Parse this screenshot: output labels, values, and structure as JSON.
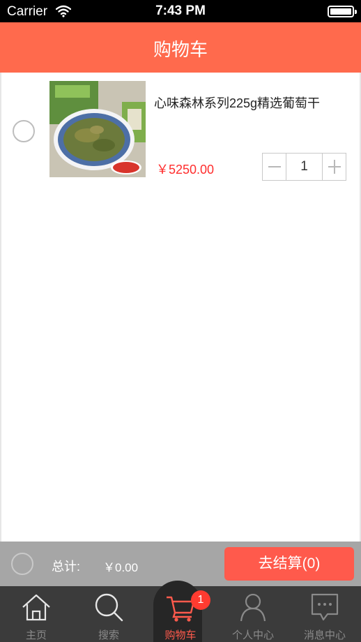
{
  "status_bar": {
    "carrier": "Carrier",
    "time": "7:43 PM"
  },
  "header": {
    "title": "购物车"
  },
  "cart": {
    "items": [
      {
        "name": "心味森林系列225g精选葡萄干",
        "price": "￥5250.00",
        "quantity": "1",
        "selected": false,
        "thumb_logo": "心味果园"
      }
    ]
  },
  "checkout": {
    "total_label": "总计:",
    "total_value": "￥0.00",
    "button_label": "去结算(0)"
  },
  "tabbar": {
    "tabs": [
      {
        "label": "主页",
        "icon": "home-icon"
      },
      {
        "label": "搜索",
        "icon": "search-icon"
      },
      {
        "label": "购物车",
        "icon": "cart-icon",
        "active": true,
        "badge": "1"
      },
      {
        "label": "个人中心",
        "icon": "user-icon"
      },
      {
        "label": "消息中心",
        "icon": "message-icon"
      }
    ]
  },
  "colors": {
    "accent": "#ff6a4d",
    "checkout_button": "#ff5a4c",
    "price": "#ff2d2d",
    "tabbar_bg": "#3b3b3b"
  }
}
